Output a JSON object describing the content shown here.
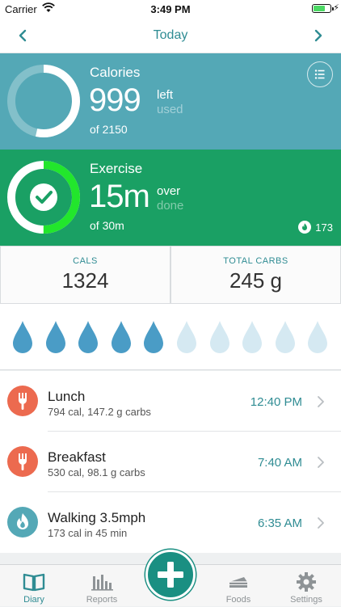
{
  "status_bar": {
    "carrier": "Carrier",
    "time": "3:49 PM"
  },
  "nav": {
    "title": "Today"
  },
  "calories": {
    "label": "Calories",
    "value": "999",
    "state": "left",
    "state_alt": "used",
    "goal_text": "of 2150",
    "progress": 0.535,
    "color": "#54a8b6"
  },
  "exercise": {
    "label": "Exercise",
    "value": "15m",
    "state": "over",
    "state_alt": "done",
    "goal_text": "of 30m",
    "burned": "173",
    "progress": 0.5,
    "color": "#1aa064"
  },
  "stats": [
    {
      "label": "CALS",
      "value": "1324"
    },
    {
      "label": "TOTAL CARBS",
      "value": "245 g"
    }
  ],
  "water": {
    "total": 10,
    "filled": 5
  },
  "entries": [
    {
      "name": "Lunch",
      "detail": "794 cal, 147.2 g carbs",
      "time": "12:40 PM",
      "icon": "fork-icon",
      "color": "#ec6a4f"
    },
    {
      "name": "Breakfast",
      "detail": "530 cal, 98.1 g carbs",
      "time": "7:40 AM",
      "icon": "fork-icon",
      "color": "#ec6a4f"
    },
    {
      "name": "Walking 3.5mph",
      "detail": "173 cal in 45 min",
      "time": "6:35 AM",
      "icon": "flame-icon",
      "color": "#54a8b6"
    }
  ],
  "tabs": [
    {
      "label": "Diary",
      "icon": "book-icon",
      "active": true
    },
    {
      "label": "Reports",
      "icon": "bar-chart-icon",
      "active": false
    },
    {
      "label": "Foods",
      "icon": "cake-icon",
      "active": false
    },
    {
      "label": "Settings",
      "icon": "gear-icon",
      "active": false
    }
  ]
}
